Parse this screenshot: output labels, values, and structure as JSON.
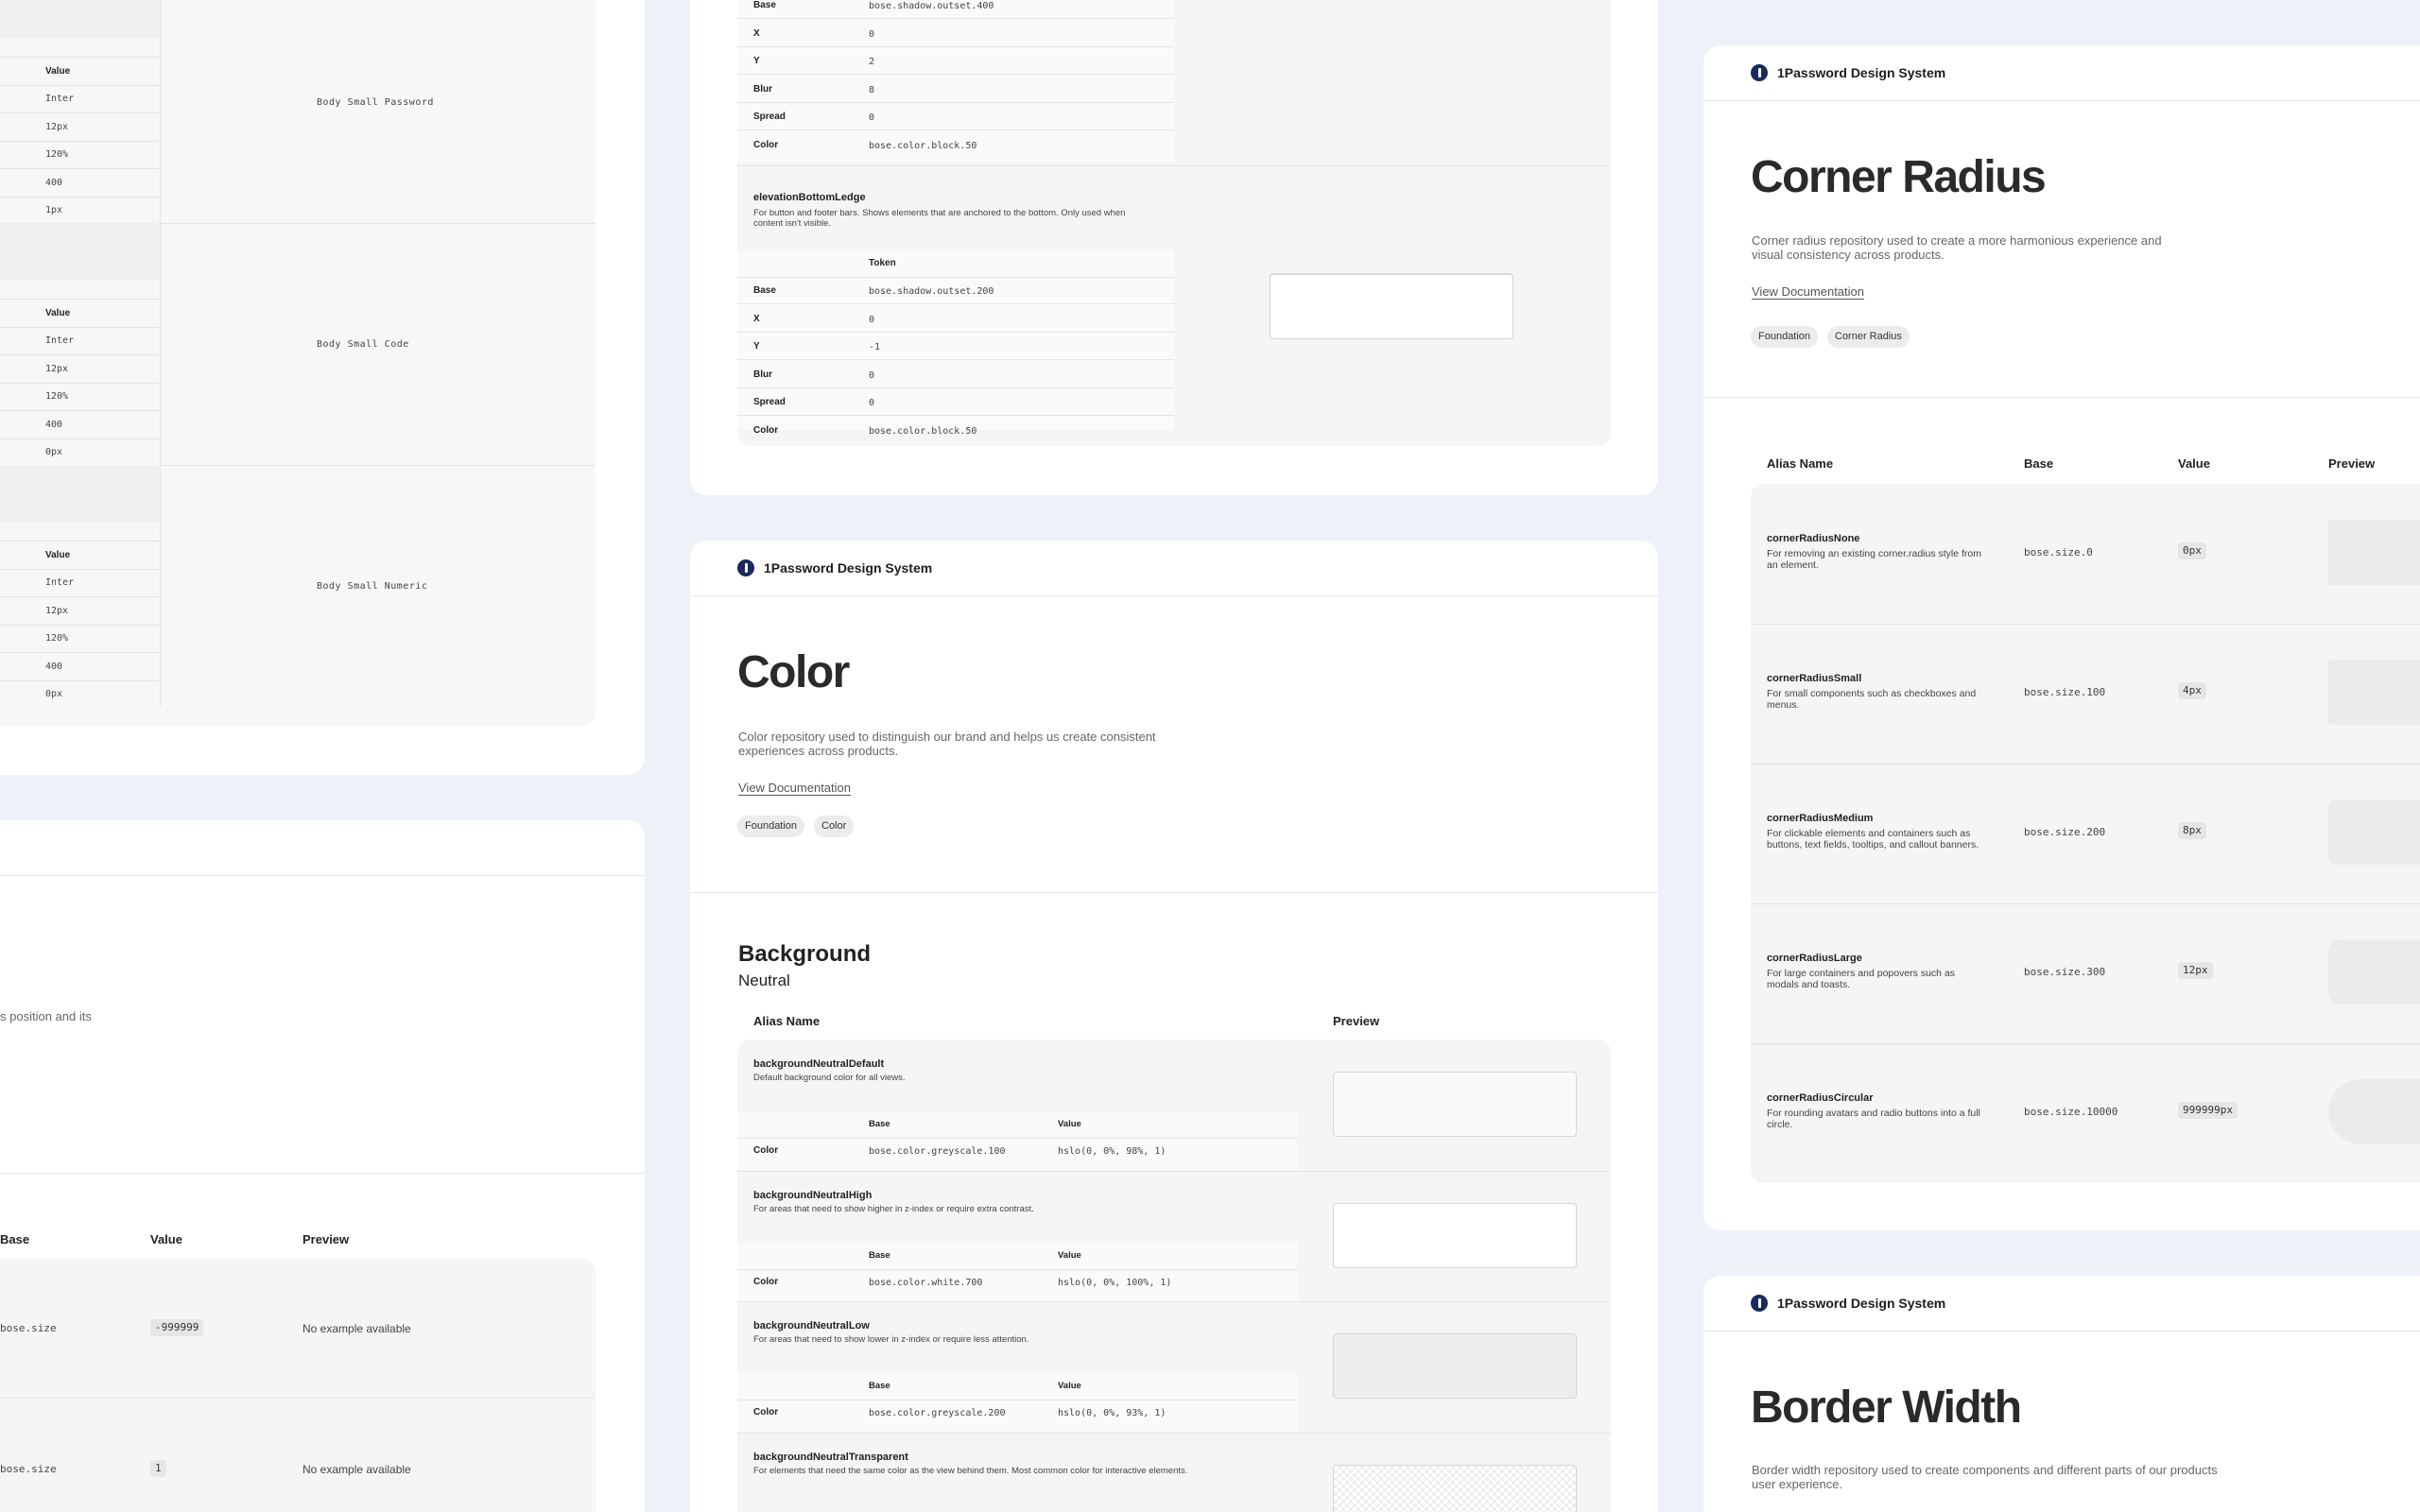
{
  "brand": "1Password Design System",
  "typography": {
    "value_header": "Value",
    "groups": [
      {
        "name": "Body Small Password",
        "values": [
          "Inter",
          "12px",
          "120%",
          "400",
          "1px"
        ]
      },
      {
        "name": "Body Small Code",
        "values": [
          "Inter",
          "12px",
          "120%",
          "400",
          "0px"
        ]
      },
      {
        "name": "Body Small Numeric",
        "values": [
          "Inter",
          "12px",
          "120%",
          "400",
          "0px"
        ]
      }
    ]
  },
  "partial_card": {
    "desc_fragment": "s position and its",
    "headers": [
      "Base",
      "Value",
      "Preview"
    ],
    "rows": [
      {
        "base": "bose.size",
        "value": "-999999",
        "preview": "No example available"
      },
      {
        "base": "bose.size",
        "value": "1",
        "preview": "No example available"
      }
    ]
  },
  "elevation": {
    "block1": {
      "rows": [
        {
          "label": "Base",
          "value": "bose.shadow.outset.400"
        },
        {
          "label": "X",
          "value": "0"
        },
        {
          "label": "Y",
          "value": "2"
        },
        {
          "label": "Blur",
          "value": "8"
        },
        {
          "label": "Spread",
          "value": "0"
        },
        {
          "label": "Color",
          "value": "bose.color.block.50"
        }
      ]
    },
    "block2": {
      "name": "elevationBottomLedge",
      "desc": "For button and footer bars. Shows elements that are anchored to the bottom. Only used when content isn't visible.",
      "token_header": "Token",
      "rows": [
        {
          "label": "Base",
          "value": "bose.shadow.outset.200"
        },
        {
          "label": "X",
          "value": "0"
        },
        {
          "label": "Y",
          "value": "-1"
        },
        {
          "label": "Blur",
          "value": "0"
        },
        {
          "label": "Spread",
          "value": "0"
        },
        {
          "label": "Color",
          "value": "bose.color.block.50"
        }
      ]
    }
  },
  "color": {
    "title": "Color",
    "desc": "Color repository used to distinguish our brand and helps us create consistent experiences across products.",
    "link": "View Documentation",
    "tags": [
      "Foundation",
      "Color"
    ],
    "section": "Background",
    "subsection": "Neutral",
    "col_alias": "Alias Name",
    "col_preview": "Preview",
    "sub_base": "Base",
    "sub_value": "Value",
    "row_label": "Color",
    "items": [
      {
        "name": "backgroundNeutralDefault",
        "desc": "Default background color for all views.",
        "base": "bose.color.greyscale.100",
        "value": "hslo(0, 0%, 98%, 1)",
        "swatch": "#fafafa"
      },
      {
        "name": "backgroundNeutralHigh",
        "desc": "For areas that need to show higher in z-index or require extra contrast.",
        "base": "bose.color.white.700",
        "value": "hslo(0, 0%, 100%, 1)",
        "swatch": "#ffffff"
      },
      {
        "name": "backgroundNeutralLow",
        "desc": "For areas that need to show lower in z-index or require less attention.",
        "base": "bose.color.greyscale.200",
        "value": "hslo(0, 0%, 93%, 1)",
        "swatch": "#eeeeee"
      },
      {
        "name": "backgroundNeutralTransparent",
        "desc": "For elements that need the same color as the view behind them. Most common color for interactive elements."
      }
    ]
  },
  "corner": {
    "title": "Corner Radius",
    "desc": "Corner radius repository used to create a more harmonious experience and visual consistency across products.",
    "link": "View Documentation",
    "tags": [
      "Foundation",
      "Corner Radius"
    ],
    "headers": [
      "Alias Name",
      "Base",
      "Value",
      "Preview"
    ],
    "items": [
      {
        "name": "cornerRadiusNone",
        "desc": "For removing an existing corner.radius style from an element.",
        "base": "bose.size.0",
        "value": "0px"
      },
      {
        "name": "cornerRadiusSmall",
        "desc": "For small components such as checkboxes and menus.",
        "base": "bose.size.100",
        "value": "4px"
      },
      {
        "name": "cornerRadiusMedium",
        "desc": "For clickable elements and containers such as buttons, text fields, tooltips, and callout banners.",
        "base": "bose.size.200",
        "value": "8px"
      },
      {
        "name": "cornerRadiusLarge",
        "desc": "For large containers and popovers such as modals and toasts.",
        "base": "bose.size.300",
        "value": "12px"
      },
      {
        "name": "cornerRadiusCircular",
        "desc": "For rounding avatars and radio buttons into a full circle.",
        "base": "bose.size.10000",
        "value": "999999px"
      }
    ]
  },
  "border": {
    "title": "Border Width",
    "desc": "Border width repository used to create components and different parts of our products user experience."
  }
}
